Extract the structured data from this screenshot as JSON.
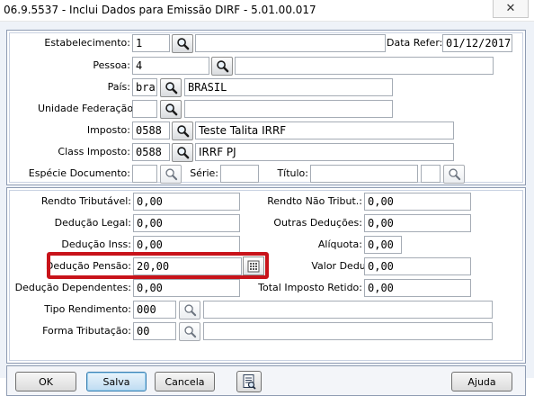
{
  "window": {
    "title": "06.9.5537 - Inclui Dados para Emissão DIRF - 5.01.00.017",
    "close_glyph": "✕"
  },
  "header": {
    "estabelecimento": {
      "label": "Estabelecimento:",
      "code": "1",
      "name": ""
    },
    "data_refer": {
      "label": "Data Refer:",
      "value": "01/12/2017"
    },
    "pessoa": {
      "label": "Pessoa:",
      "code": "4",
      "name": ""
    },
    "pais": {
      "label": "País:",
      "code": "bra",
      "name": "BRASIL"
    },
    "unidade_federacao": {
      "label": "Unidade Federação:",
      "code": "",
      "name": ""
    },
    "imposto": {
      "label": "Imposto:",
      "code": "0588",
      "name": "Teste Talita IRRF"
    },
    "class_imposto": {
      "label": "Class Imposto:",
      "code": "0588",
      "name": "IRRF PJ"
    },
    "especie_documento": {
      "label": "Espécie Documento:",
      "value": ""
    },
    "serie": {
      "label": "Série:",
      "value": ""
    },
    "titulo": {
      "label": "Título:",
      "value": "",
      "value2": ""
    }
  },
  "values": {
    "rendto_tributavel": {
      "label": "Rendto Tributável:",
      "value": "0,00"
    },
    "rendto_nao_tribut": {
      "label": "Rendto Não Tribut.:",
      "value": "0,00"
    },
    "deducao_legal": {
      "label": "Dedução Legal:",
      "value": "0,00"
    },
    "outras_deducoes": {
      "label": "Outras Deduções:",
      "value": "0,00"
    },
    "deducao_inss": {
      "label": "Dedução Inss:",
      "value": "0,00"
    },
    "aliquota": {
      "label": "Alíquota:",
      "value": "0,00"
    },
    "deducao_pensao": {
      "label": "Dedução Pensão:",
      "value": "20,00"
    },
    "valor_deducao": {
      "label": "Valor Deducao:",
      "value": "0,00"
    },
    "deducao_dependentes": {
      "label": "Dedução Dependentes:",
      "value": "0,00"
    },
    "total_imposto_retido": {
      "label": "Total Imposto Retido:",
      "value": "0,00"
    },
    "tipo_rendimento": {
      "label": "Tipo Rendimento:",
      "code": "000",
      "name": ""
    },
    "forma_tributacao": {
      "label": "Forma Tributação:",
      "code": "00",
      "name": ""
    }
  },
  "buttons": {
    "ok": "OK",
    "salva": "Salva",
    "cancela": "Cancela",
    "ajuda": "Ajuda"
  },
  "icons": {
    "search": "search-icon",
    "calculator": "calculator-icon",
    "report": "report-icon"
  },
  "colors": {
    "highlight": "#c8131a",
    "primary_button": "#bfdcf2",
    "panel_border": "#8e9bb2"
  }
}
